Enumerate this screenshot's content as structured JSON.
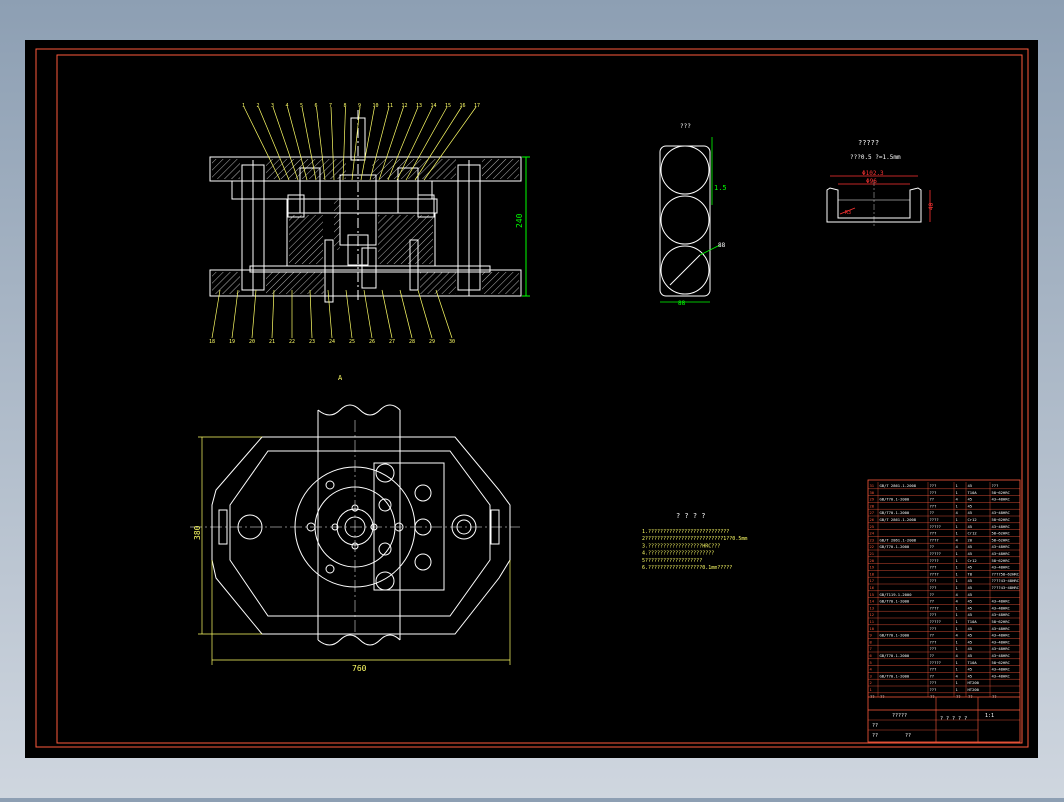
{
  "colors": {
    "background": "#000000",
    "frame": "#ff5a3c",
    "geometry": "#ffffff",
    "dimension": "#00ff00",
    "leader": "#ffff66",
    "callout": "#ff3333"
  },
  "main_view": {
    "dim_height": "240",
    "top_callouts": [
      "1",
      "2",
      "3",
      "4",
      "5",
      "6",
      "7",
      "8",
      "9",
      "10",
      "11",
      "12",
      "13",
      "14",
      "15",
      "16",
      "17"
    ],
    "bottom_callouts": [
      "18",
      "19",
      "20",
      "21",
      "22",
      "23",
      "24",
      "25",
      "26",
      "27",
      "28",
      "29",
      "30"
    ]
  },
  "plan_view": {
    "dim_width": "760",
    "dim_height": "380",
    "section_mark": "A"
  },
  "strip_layout": {
    "label": "???",
    "dim_pitch": "1.5",
    "dim_width": "88",
    "dim_diag": "88"
  },
  "part": {
    "title": "?????",
    "subtitle": "???0.5    ?=1.5mm",
    "dim_outer": "Φ102.3",
    "dim_inner": "Φ96",
    "dim_height": "40",
    "dim_fillet": "R3"
  },
  "notes": {
    "title": "? ? ? ?",
    "lines": [
      "1.???????????????????????????",
      "2??????????????????????????1??0.5mm",
      "3.??????????????????HRC???",
      "4.??????????????????????",
      "5???????????????????",
      "6.??????????????????0.1mm?????"
    ]
  },
  "bom": {
    "rows": [
      [
        "31",
        "GB/T 2861.1-2008",
        "???",
        "1",
        "45",
        "???"
      ],
      [
        "30",
        "",
        "???",
        "1",
        "T10A",
        "58~62HRC"
      ],
      [
        "29",
        "GB/T70.1-2000",
        "??",
        "4",
        "45",
        "43~48HRC"
      ],
      [
        "28",
        "",
        "???",
        "1",
        "45",
        ""
      ],
      [
        "27",
        "GB/T70.1-2000",
        "??",
        "4",
        "45",
        "43~48HRC"
      ],
      [
        "26",
        "GB/T 2861.1-2008",
        "????",
        "1",
        "Cr12",
        "58~62HRC"
      ],
      [
        "25",
        "",
        "?????",
        "1",
        "45",
        "43~48HRC"
      ],
      [
        "24",
        "",
        "???",
        "1",
        "Cr12",
        "58~62HRC"
      ],
      [
        "23",
        "GB/T 2861.1-2008",
        "????",
        "4",
        "20",
        "58~62HRC"
      ],
      [
        "22",
        "GB/T70.1-2000",
        "??",
        "4",
        "45",
        "43~48HRC"
      ],
      [
        "21",
        "",
        "?????",
        "1",
        "45",
        "43~48HRC"
      ],
      [
        "20",
        "",
        "????",
        "1",
        "Cr12",
        "58~62HRC"
      ],
      [
        "19",
        "",
        "???",
        "1",
        "45",
        "43~48HRC"
      ],
      [
        "18",
        "",
        "????",
        "1",
        "T8",
        "????58~62HRC"
      ],
      [
        "17",
        "",
        "???",
        "1",
        "45",
        "????43~48HRC"
      ],
      [
        "16",
        "",
        "???",
        "1",
        "45",
        "????43~48HRC"
      ],
      [
        "15",
        "GB/T119.1-2000",
        "??",
        "4",
        "45",
        ""
      ],
      [
        "14",
        "GB/T70.1-2000",
        "??",
        "4",
        "45",
        "43~48HRC"
      ],
      [
        "13",
        "",
        "????",
        "1",
        "45",
        "43~48HRC"
      ],
      [
        "12",
        "",
        "???",
        "1",
        "45",
        "43~48HRC"
      ],
      [
        "11",
        "",
        "?????",
        "1",
        "T10A",
        "58~62HRC"
      ],
      [
        "10",
        "",
        "???",
        "1",
        "45",
        "43~48HRC"
      ],
      [
        "9",
        "GB/T70.1-2000",
        "??",
        "4",
        "45",
        "43~48HRC"
      ],
      [
        "8",
        "",
        "???",
        "1",
        "45",
        "43~48HRC"
      ],
      [
        "7",
        "",
        "???",
        "1",
        "45",
        "43~48HRC"
      ],
      [
        "6",
        "GB/T70.1-2000",
        "??",
        "4",
        "45",
        "43~48HRC"
      ],
      [
        "5",
        "",
        "?????",
        "1",
        "T10A",
        "58~62HRC"
      ],
      [
        "4",
        "",
        "???",
        "1",
        "45",
        "43~48HRC"
      ],
      [
        "3",
        "GB/T70.1-2000",
        "??",
        "4",
        "45",
        "43~48HRC"
      ],
      [
        "2",
        "",
        "???",
        "1",
        "HT200",
        ""
      ],
      [
        "1",
        "",
        "???",
        "1",
        "HT200",
        ""
      ]
    ],
    "header": [
      "??",
      "??",
      "??",
      "??",
      "??",
      "??"
    ],
    "title_block": {
      "drawing_name": "?????",
      "scale": "1:1",
      "sheet": "? ? ? ? ?",
      "designer": "??",
      "checker": "??",
      "approver": "??"
    }
  }
}
